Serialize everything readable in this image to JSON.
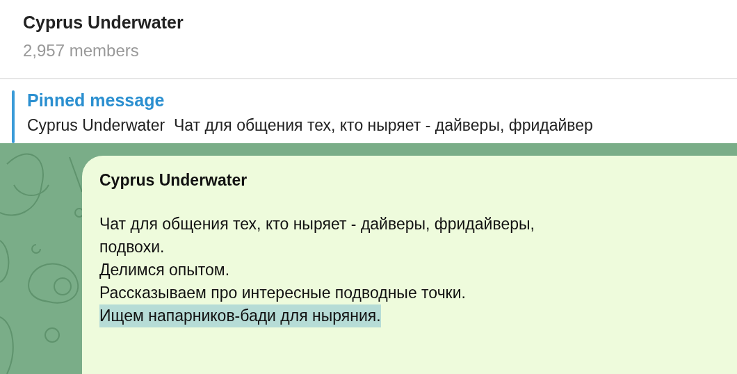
{
  "header": {
    "title": "Cyprus Underwater",
    "subtitle": "2,957 members"
  },
  "pinned": {
    "label": "Pinned message",
    "preview": "Cyprus Underwater  Чат для общения тех, кто ныряет - дайверы, фридайвер"
  },
  "message": {
    "title": "Cyprus Underwater",
    "lines": [
      {
        "text": "Чат для общения тех, кто ныряет - дайверы, фридайверы,",
        "highlighted": false
      },
      {
        "text": "подвохи.",
        "highlighted": false
      },
      {
        "text": "Делимся опытом.",
        "highlighted": false
      },
      {
        "text": "Рассказываем про интересные подводные точки.",
        "highlighted": false
      },
      {
        "text": "Ищем напарников-бади для ныряния.",
        "highlighted": true
      }
    ]
  }
}
